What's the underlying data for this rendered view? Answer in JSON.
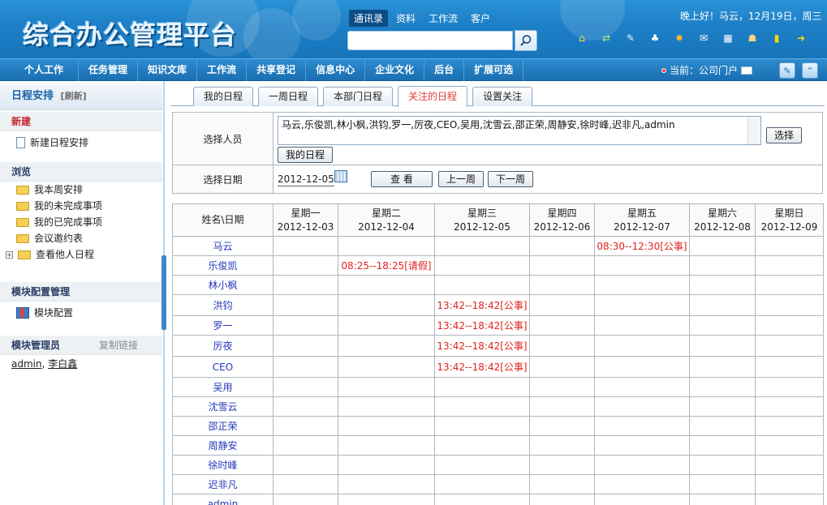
{
  "header": {
    "logo_text": "综合办公管理平台",
    "top_tabs": [
      "通讯录",
      "资料",
      "工作流",
      "客户"
    ],
    "greeting": "晚上好！马云，12月19日，周三",
    "tool_icons": [
      "home-icon",
      "swap-icon",
      "edit-icon",
      "shirt-icon",
      "gear-icon",
      "mail-icon",
      "calendar-icon",
      "user-card-icon",
      "note-icon",
      "exit-icon"
    ]
  },
  "nav": {
    "items": [
      "个人工作",
      "任务管理",
      "知识文库",
      "工作流",
      "共享登记",
      "信息中心",
      "企业文化",
      "后台",
      "扩展可选"
    ],
    "current": "当前：公司门户"
  },
  "sidebar": {
    "title": "日程安排",
    "refresh": "[刷新]",
    "new_section": "新建",
    "new_item": "新建日程安排",
    "browse_section": "浏览",
    "browse_items": [
      "我本周安排",
      "我的未完成事项",
      "我的已完成事项",
      "会议邀约表",
      "查看他人日程"
    ],
    "module_section": "模块配置管理",
    "module_item": "模块配置",
    "admin_section": "模块管理员",
    "copy_link": "复制链接",
    "admins": [
      "admin",
      "李白鑫"
    ]
  },
  "tabs": [
    "我的日程",
    "一周日程",
    "本部门日程",
    "关注的日程",
    "设置关注"
  ],
  "active_tab": 3,
  "filter": {
    "person_label": "选择人员",
    "persons_value": "马云,乐俊凯,林小枫,洪钧,罗一,厉夜,CEO,吴用,沈雪云,邵正荣,周静安,徐时峰,迟非凡,admin",
    "select_btn": "选择",
    "my_schedule_btn": "我的日程",
    "date_label": "选择日期",
    "date_value": "2012-12-05",
    "view_btn": "查 看",
    "prev_week_btn": "上一周",
    "next_week_btn": "下一周"
  },
  "schedule": {
    "corner": "姓名\\日期",
    "days": [
      {
        "name": "星期一",
        "date": "2012-12-03"
      },
      {
        "name": "星期二",
        "date": "2012-12-04"
      },
      {
        "name": "星期三",
        "date": "2012-12-05"
      },
      {
        "name": "星期四",
        "date": "2012-12-06"
      },
      {
        "name": "星期五",
        "date": "2012-12-07"
      },
      {
        "name": "星期六",
        "date": "2012-12-08"
      },
      {
        "name": "星期日",
        "date": "2012-12-09"
      }
    ],
    "rows": [
      {
        "name": "马云",
        "cells": [
          "",
          "",
          "",
          "",
          "08:30--12:30[公事]",
          "",
          ""
        ]
      },
      {
        "name": "乐俊凯",
        "cells": [
          "",
          "08:25--18:25[请假]",
          "",
          "",
          "",
          "",
          ""
        ]
      },
      {
        "name": "林小枫",
        "cells": [
          "",
          "",
          "",
          "",
          "",
          "",
          ""
        ]
      },
      {
        "name": "洪钧",
        "cells": [
          "",
          "",
          "13:42--18:42[公事]",
          "",
          "",
          "",
          ""
        ]
      },
      {
        "name": "罗一",
        "cells": [
          "",
          "",
          "13:42--18:42[公事]",
          "",
          "",
          "",
          ""
        ]
      },
      {
        "name": "厉夜",
        "cells": [
          "",
          "",
          "13:42--18:42[公事]",
          "",
          "",
          "",
          ""
        ]
      },
      {
        "name": "CEO",
        "cells": [
          "",
          "",
          "13:42--18:42[公事]",
          "",
          "",
          "",
          ""
        ]
      },
      {
        "name": "吴用",
        "cells": [
          "",
          "",
          "",
          "",
          "",
          "",
          ""
        ]
      },
      {
        "name": "沈雪云",
        "cells": [
          "",
          "",
          "",
          "",
          "",
          "",
          ""
        ]
      },
      {
        "name": "邵正荣",
        "cells": [
          "",
          "",
          "",
          "",
          "",
          "",
          ""
        ]
      },
      {
        "name": "周静安",
        "cells": [
          "",
          "",
          "",
          "",
          "",
          "",
          ""
        ]
      },
      {
        "name": "徐时峰",
        "cells": [
          "",
          "",
          "",
          "",
          "",
          "",
          ""
        ]
      },
      {
        "name": "迟非凡",
        "cells": [
          "",
          "",
          "",
          "",
          "",
          "",
          ""
        ]
      },
      {
        "name": "admin",
        "cells": [
          "",
          "",
          "",
          "",
          "",
          "",
          ""
        ]
      }
    ]
  }
}
